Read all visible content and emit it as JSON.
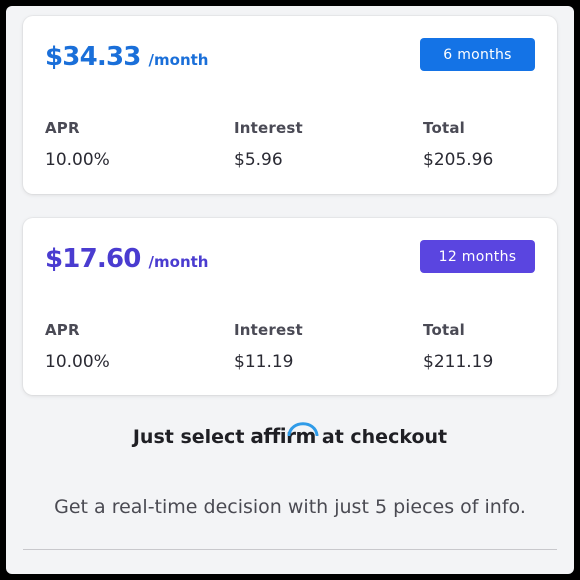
{
  "plans": [
    {
      "amount": "$34.33",
      "per_month": "/month",
      "term": "6 months",
      "accent": "#1a6fd9",
      "badge_color": "#1473e6",
      "apr_label": "APR",
      "apr_value": "10.00%",
      "interest_label": "Interest",
      "interest_value": "$5.96",
      "total_label": "Total",
      "total_value": "$205.96"
    },
    {
      "amount": "$17.60",
      "per_month": "/month",
      "term": "12 months",
      "accent": "#4a3cd0",
      "badge_color": "#5a45e0",
      "apr_label": "APR",
      "apr_value": "10.00%",
      "interest_label": "Interest",
      "interest_value": "$11.19",
      "total_label": "Total",
      "total_value": "$211.19"
    }
  ],
  "checkout": {
    "prefix": "Just select",
    "logo_text": "affirm",
    "suffix": "at checkout",
    "logo_arc_color": "#2f9be8",
    "decision_text": "Get a real-time decision with just 5 pieces of info."
  }
}
